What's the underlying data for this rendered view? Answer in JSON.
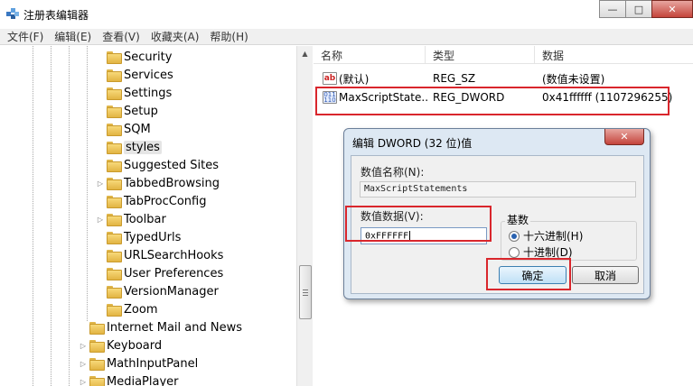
{
  "window": {
    "title": "注册表编辑器",
    "controls": {
      "minimize": "—",
      "maximize": "□",
      "close": "✕"
    }
  },
  "menu": [
    "文件(F)",
    "编辑(E)",
    "查看(V)",
    "收藏夹(A)",
    "帮助(H)"
  ],
  "tree": {
    "items": [
      {
        "label": "Security",
        "expander": ""
      },
      {
        "label": "Services",
        "expander": ""
      },
      {
        "label": "Settings",
        "expander": ""
      },
      {
        "label": "Setup",
        "expander": ""
      },
      {
        "label": "SQM",
        "expander": ""
      },
      {
        "label": "styles",
        "expander": "",
        "selected": true
      },
      {
        "label": "Suggested Sites",
        "expander": ""
      },
      {
        "label": "TabbedBrowsing",
        "expander": "▷"
      },
      {
        "label": "TabProcConfig",
        "expander": ""
      },
      {
        "label": "Toolbar",
        "expander": "▷"
      },
      {
        "label": "TypedUrls",
        "expander": ""
      },
      {
        "label": "URLSearchHooks",
        "expander": ""
      },
      {
        "label": "User Preferences",
        "expander": ""
      },
      {
        "label": "VersionManager",
        "expander": ""
      },
      {
        "label": "Zoom",
        "expander": ""
      },
      {
        "label": "Internet Mail and News",
        "expander": ""
      },
      {
        "label": "Keyboard",
        "expander": "▷"
      },
      {
        "label": "MathInputPanel",
        "expander": "▷"
      },
      {
        "label": "MediaPlayer",
        "expander": "▷"
      }
    ]
  },
  "values": {
    "headers": [
      "名称",
      "类型",
      "数据"
    ],
    "rows": [
      {
        "icon": "ab",
        "name": "(默认)",
        "type": "REG_SZ",
        "data": "(数值未设置)"
      },
      {
        "icon": "bin",
        "name": "MaxScriptState...",
        "type": "REG_DWORD",
        "data": "0x41ffffff (1107296255)"
      }
    ]
  },
  "dialog": {
    "title": "编辑 DWORD (32 位)值",
    "close": "✕",
    "name_label": "数值名称(N):",
    "name_value": "MaxScriptStatements",
    "data_label": "数值数据(V):",
    "data_value": "0xFFFFFF",
    "base_label": "基数",
    "radio_hex": "十六进制(H)",
    "radio_dec": "十进制(D)",
    "ok": "确定",
    "cancel": "取消"
  },
  "colors": {
    "highlight": "#d9262c",
    "dialog_frame": "#dde8f3"
  }
}
